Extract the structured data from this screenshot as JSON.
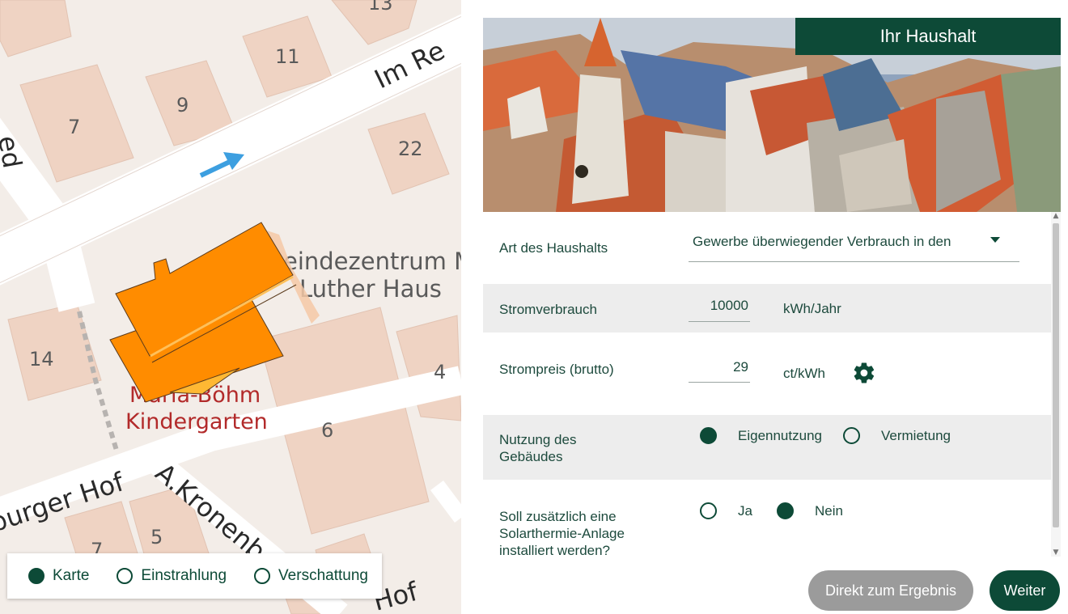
{
  "colors": {
    "brand_green": "#0d4a37",
    "building_orange": "#ff8c00",
    "grey_button": "#9b9b9b"
  },
  "map": {
    "street_labels": {
      "im_re": "Im Re",
      "burger_hof": "burger Hof",
      "kronenb": "A.Kronenb",
      "hof": "Hof",
      "ed": "ed"
    },
    "building_numbers": {
      "n13": "13",
      "n11": "11",
      "n7a": "7",
      "n9": "9",
      "n22": "22",
      "n14": "14",
      "n4": "4",
      "n6": "6",
      "n7b": "7",
      "n5": "5"
    },
    "poi": {
      "line1": "eindezentrum M",
      "line2": "Luther Haus",
      "kg1": "Maria-Böhm",
      "kg2": "Kindergarten"
    },
    "layer_switch": [
      {
        "label": "Karte",
        "selected": true
      },
      {
        "label": "Einstrahlung",
        "selected": false
      },
      {
        "label": "Verschattung",
        "selected": false
      }
    ]
  },
  "hero": {
    "title": "Ihr Haushalt"
  },
  "form": {
    "household_type": {
      "label": "Art des Haushalts",
      "value": "Gewerbe überwiegender Verbrauch in den",
      "icon": "caret-down-icon"
    },
    "consumption": {
      "label": "Stromverbrauch",
      "value": "10000",
      "unit": "kWh/Jahr"
    },
    "price": {
      "label": "Strompreis (brutto)",
      "value": "29",
      "unit": "ct/kWh",
      "icon": "gear-icon"
    },
    "usage": {
      "label_line1": "Nutzung des",
      "label_line2": "Gebäudes",
      "options": [
        {
          "label": "Eigennutzung",
          "selected": true
        },
        {
          "label": "Vermietung",
          "selected": false
        }
      ]
    },
    "solarthermal": {
      "label_line1": "Soll zusätzlich eine",
      "label_line2": "Solarthermie-Anlage",
      "label_line3": "installiert werden?",
      "options": [
        {
          "label": "Ja",
          "selected": false
        },
        {
          "label": "Nein",
          "selected": true
        }
      ]
    }
  },
  "buttons": {
    "direct": "Direkt zum Ergebnis",
    "next": "Weiter"
  }
}
